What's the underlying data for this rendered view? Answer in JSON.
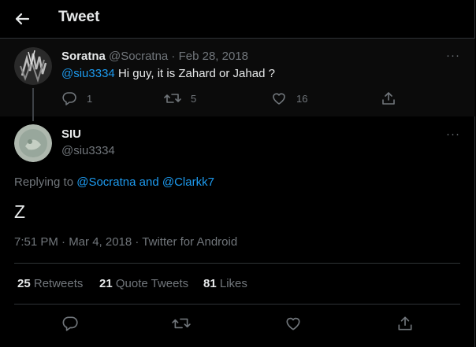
{
  "header": {
    "title": "Tweet"
  },
  "parent_tweet": {
    "author_name": "Soratna",
    "meta": "@Socratna · Feb 28, 2018",
    "mention": "@siu3334",
    "text": " Hi guy, it is Zahard or Jahad ?",
    "more": "···",
    "reply_count": "1",
    "retweet_count": "5",
    "like_count": "16"
  },
  "main_tweet": {
    "author_name": "SIU",
    "handle": "@siu3334",
    "more": "···",
    "replying_prefix": "Replying to ",
    "replying_to": "@Socratna and @Clarkk7",
    "text": "Z",
    "timestamp": "7:51 PM · Mar 4, 2018 · Twitter for Android"
  },
  "stats": {
    "retweets_count": "25",
    "retweets_label": "Retweets",
    "quotes_count": "21",
    "quotes_label": "Quote Tweets",
    "likes_count": "81",
    "likes_label": "Likes"
  },
  "colors": {
    "background": "#000000",
    "text_primary": "#e7e9ea",
    "text_secondary": "#71767b",
    "link": "#1d9bf0",
    "divider": "#2f3336"
  },
  "icons": [
    "back-arrow-icon",
    "more-icon",
    "reply-icon",
    "retweet-icon",
    "like-icon",
    "share-icon"
  ]
}
